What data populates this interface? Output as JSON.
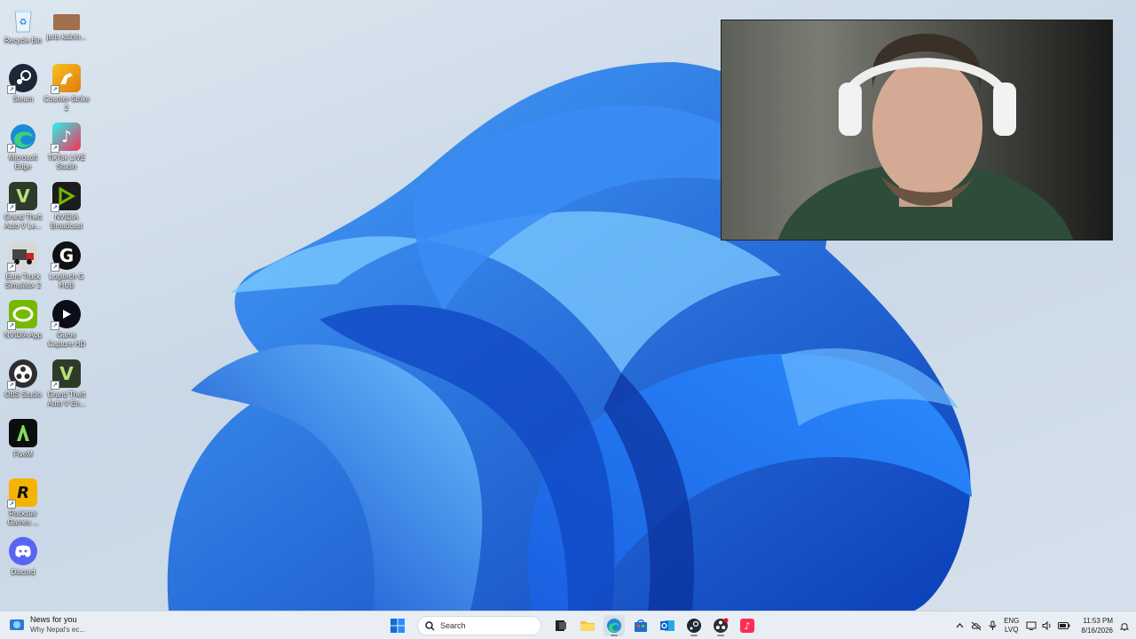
{
  "desktop": {
    "icons": [
      {
        "label": "Recycle Bin",
        "icon": "recycle-bin-icon",
        "color": "#5fa8d9"
      },
      {
        "label": "juris kalnin...",
        "icon": "photo-thumbnail-icon",
        "color": "#a0704f"
      },
      {
        "label": "Steam",
        "icon": "steam-icon",
        "color": "#1b2838"
      },
      {
        "label": "Counter-Strike 2",
        "icon": "counter-strike-icon",
        "color": "#e8a11b"
      },
      {
        "label": "Microsoft Edge",
        "icon": "edge-icon",
        "color": "#1d8ad8"
      },
      {
        "label": "TikTok LIVE Studio",
        "icon": "tiktok-live-icon",
        "color": "#ff2d55"
      },
      {
        "label": "Grand Theft Auto V Le...",
        "icon": "gta-v-icon",
        "color": "#2f3a2a"
      },
      {
        "label": "NVIDIA Broadcast",
        "icon": "nvidia-broadcast-icon",
        "color": "#1c1c1c"
      },
      {
        "label": "Euro Truck Simulator 2",
        "icon": "euro-truck-icon",
        "color": "#3a3a3a"
      },
      {
        "label": "Logitech G HUB",
        "icon": "logitech-g-icon",
        "color": "#111111"
      },
      {
        "label": "NVIDIA App",
        "icon": "nvidia-app-icon",
        "color": "#76b900"
      },
      {
        "label": "Game Capture HD",
        "icon": "game-capture-icon",
        "color": "#0d0d1a"
      },
      {
        "label": "OBS Studio",
        "icon": "obs-icon",
        "color": "#302e31"
      },
      {
        "label": "Grand Theft Auto V En...",
        "icon": "gta-v-enhanced-icon",
        "color": "#2f3a2a"
      },
      {
        "label": "FiveM",
        "icon": "fivem-icon",
        "color": "#0d0d0d"
      },
      {
        "label": "Rockstar Games ...",
        "icon": "rockstar-icon",
        "color": "#f4b400"
      },
      {
        "label": "Discord",
        "icon": "discord-icon",
        "color": "#5865f2"
      }
    ]
  },
  "webcam": {
    "icon": "webcam-overlay"
  },
  "taskbar": {
    "news_title": "News for you",
    "news_subtitle": "Why Nepal's ec...",
    "search_placeholder": "Search",
    "apps": [
      "start-icon",
      "task-view-icon",
      "file-explorer-icon",
      "edge-icon",
      "store-icon",
      "outlook-icon",
      "steam-icon",
      "obs-icon",
      "tiktok-icon"
    ],
    "lang_top": "ENG",
    "lang_bottom": "LVQ",
    "time": "11:53 PM",
    "date": "8/16/2026"
  },
  "colors": {
    "accent": "#1a6fd6",
    "taskbar_bg": "#e9eef4"
  }
}
